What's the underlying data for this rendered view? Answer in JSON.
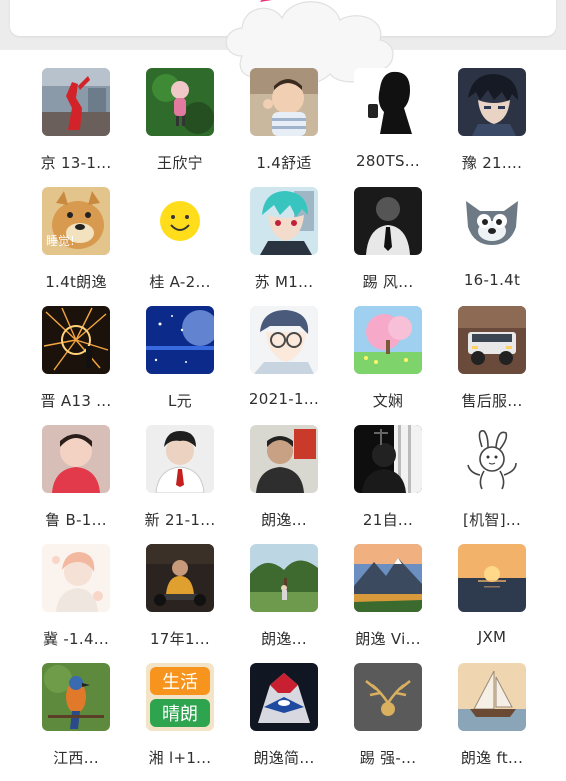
{
  "contacts": [
    {
      "name": "京 13-1...",
      "icon": "red-sculpture-avatar-icon"
    },
    {
      "name": "王欣宁",
      "icon": "figurine-avatar-icon"
    },
    {
      "name": "1.4舒适",
      "icon": "baby-avatar-icon"
    },
    {
      "name": "280TS...",
      "icon": "silhouette-avatar-icon"
    },
    {
      "name": "豫 21....",
      "icon": "anime-boy-avatar-icon"
    },
    {
      "name": "1.4t朗逸",
      "icon": "doge-avatar-icon",
      "overlay_text": "睡觉!"
    },
    {
      "name": "桂 A-2...",
      "icon": "smiley-avatar-icon"
    },
    {
      "name": "苏 M1...",
      "icon": "anime-teal-hair-avatar-icon"
    },
    {
      "name": "踢 风...",
      "icon": "bw-boy-avatar-icon"
    },
    {
      "name": "16-1.4t",
      "icon": "cartoon-wolf-avatar-icon"
    },
    {
      "name": "晋 A13 ...",
      "icon": "steel-wool-sparks-avatar-icon"
    },
    {
      "name": "L元",
      "icon": "blue-night-avatar-icon"
    },
    {
      "name": "2021-1...",
      "icon": "anime-glasses-avatar-icon"
    },
    {
      "name": "文娴",
      "icon": "pink-tree-avatar-icon"
    },
    {
      "name": "售后服...",
      "icon": "offroad-car-avatar-icon"
    },
    {
      "name": "鲁 B-1...",
      "icon": "toddler-avatar-icon"
    },
    {
      "name": "新 21-1...",
      "icon": "young-man-avatar-icon"
    },
    {
      "name": "朗逸...",
      "icon": "man-selfie-avatar-icon"
    },
    {
      "name": "21自...",
      "icon": "dark-portrait-avatar-icon"
    },
    {
      "name": "[机智]...",
      "icon": "rabbit-sketch-avatar-icon"
    },
    {
      "name": "冀 -1.4...",
      "icon": "watercolor-girl-avatar-icon"
    },
    {
      "name": "17年1...",
      "icon": "man-sitting-avatar-icon"
    },
    {
      "name": "朗逸...",
      "icon": "palm-park-avatar-icon"
    },
    {
      "name": "朗逸 Vi...",
      "icon": "mountain-landscape-avatar-icon"
    },
    {
      "name": "JXM",
      "icon": "sunset-sea-avatar-icon"
    },
    {
      "name": "江西...",
      "icon": "bird-avatar-icon"
    },
    {
      "name": "湘 l+1...",
      "icon": "life-sticker-avatar-icon",
      "overlay_text": [
        "生活",
        "晴朗"
      ]
    },
    {
      "name": "朗逸简...",
      "icon": "motorcycle-avatar-icon"
    },
    {
      "name": "踢 强-...",
      "icon": "deer-antler-avatar-icon"
    },
    {
      "name": "朗逸 ft...",
      "icon": "sailboat-avatar-icon"
    }
  ]
}
